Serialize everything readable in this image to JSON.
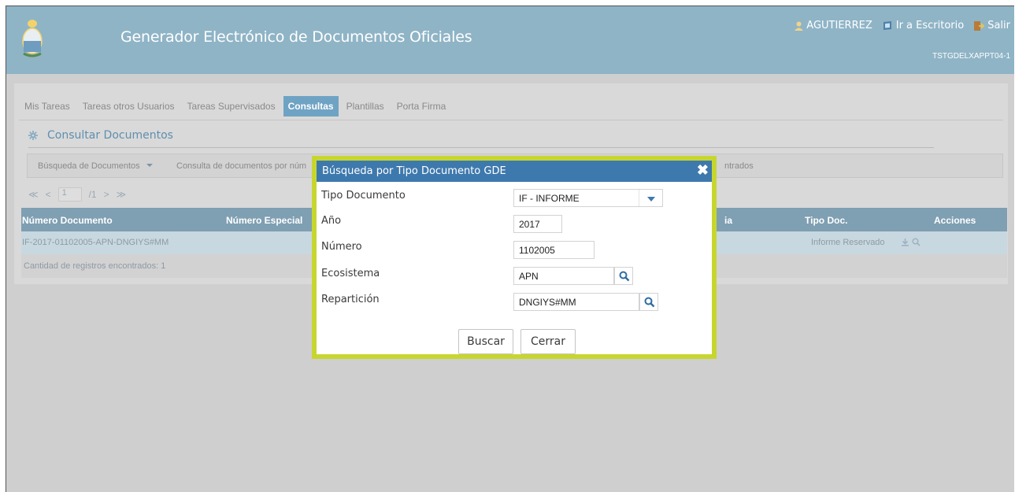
{
  "header": {
    "app_title": "Generador Electrónico de Documentos Oficiales",
    "username": "AGUTIERREZ",
    "escritorio_label": "Ir a Escritorio",
    "salir_label": "Salir",
    "hostname": "TSTGDELXAPPT04-1"
  },
  "tabs": [
    {
      "label": "Mis Tareas"
    },
    {
      "label": "Tareas otros Usuarios"
    },
    {
      "label": "Tareas Supervisados"
    },
    {
      "label": "Consultas",
      "active": true
    },
    {
      "label": "Plantillas"
    },
    {
      "label": "Porta Firma"
    }
  ],
  "section": {
    "title": "Consultar Documentos"
  },
  "toolbar": {
    "busqueda": "Búsqueda de Documentos",
    "consulta": "Consulta de documentos por núm",
    "encontrados": "ntrados"
  },
  "pager": {
    "first": "≪",
    "prev": "<",
    "page": "1",
    "total": "/1",
    "next": ">",
    "last": "≫"
  },
  "grid": {
    "columns": {
      "numero": "Número Documento",
      "especial": "Número Especial",
      "partial": "ia",
      "tipo": "Tipo Doc.",
      "acciones": "Acciones"
    },
    "row": {
      "numero": "IF-2017-01102005-APN-DNGIYS#MM",
      "tipo": "Informe Reservado"
    },
    "footer": "Cantidad de registros encontrados: 1"
  },
  "modal": {
    "title": "Búsqueda por Tipo Documento GDE",
    "labels": {
      "tipo": "Tipo Documento",
      "anio": "Año",
      "numero": "Número",
      "ecosistema": "Ecosistema",
      "reparticion": "Repartición"
    },
    "values": {
      "tipo": "IF - INFORME",
      "anio": "2017",
      "numero": "1102005",
      "ecosistema": "APN",
      "reparticion": "DNGIYS#MM"
    },
    "buscar_label": "Buscar",
    "cerrar_label": "Cerrar"
  },
  "colors": {
    "header_bg": "#8fb4c6",
    "modal_header": "#3e79ad",
    "highlight_border": "#c7d62f",
    "active_tab": "#6fa3c4"
  }
}
